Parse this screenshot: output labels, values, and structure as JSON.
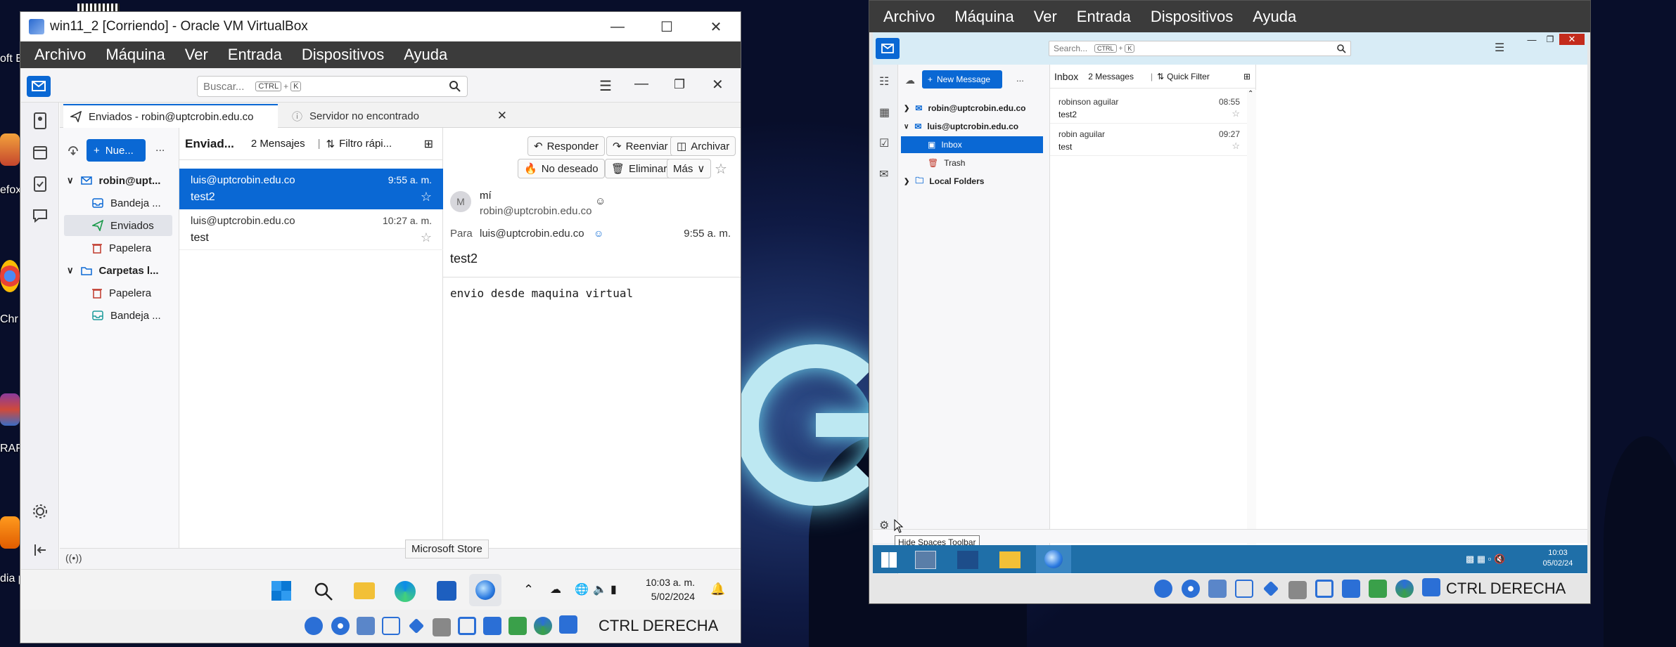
{
  "desktop": {
    "left_labels": [
      "oft E",
      "efox",
      "Chr",
      "RAF",
      "dia p"
    ],
    "tooltip_microsoft_store": "Microsoft Store"
  },
  "vbox_left": {
    "title": "win11_2 [Corriendo] - Oracle VM VirtualBox",
    "menu": [
      "Archivo",
      "Máquina",
      "Ver",
      "Entrada",
      "Dispositivos",
      "Ayuda"
    ],
    "host_key": "CTRL DERECHA",
    "thunderbird": {
      "search_placeholder": "Buscar...",
      "search_kbd1": "CTRL",
      "search_plus": "+",
      "search_kbd2": "K",
      "tab_active": "Enviados - robin@uptcrobin.edu.co",
      "tab_other": "Servidor no encontrado",
      "new_button": "Nue...",
      "more_dots": "...",
      "folders": {
        "account1": "robin@upt...",
        "inbox": "Bandeja ...",
        "sent": "Enviados",
        "trash": "Papelera",
        "local": "Carpetas l...",
        "local_trash": "Papelera",
        "local_inbox": "Bandeja ..."
      },
      "list_header": {
        "folder": "Enviad...",
        "count": "2 Mensajes",
        "filter": "Filtro rápi..."
      },
      "messages": [
        {
          "to": "luis@uptcrobin.edu.co",
          "time": "9:55 a. m.",
          "subject": "test2"
        },
        {
          "to": "luis@uptcrobin.edu.co",
          "time": "10:27 a. m.",
          "subject": "test"
        }
      ],
      "actions": {
        "reply": "Responder",
        "forward": "Reenviar",
        "archive": "Archivar",
        "junk": "No deseado",
        "delete": "Eliminar",
        "more": "Más"
      },
      "message": {
        "avatar": "M",
        "from_name": "mí",
        "from_email": "robin@uptcrobin.edu.co",
        "to_label": "Para",
        "to_email": "luis@uptcrobin.edu.co",
        "time": "9:55 a. m.",
        "subject": "test2",
        "body": "envio desde maquina virtual"
      }
    },
    "taskbar": {
      "time": "10:03 a. m.",
      "date": "5/02/2024"
    }
  },
  "vbox_right": {
    "menu": [
      "Archivo",
      "Máquina",
      "Ver",
      "Entrada",
      "Dispositivos",
      "Ayuda"
    ],
    "host_key": "CTRL DERECHA",
    "thunderbird": {
      "search_placeholder": "Search...",
      "search_kbd1": "CTRL",
      "search_plus": "+",
      "search_kbd2": "K",
      "new_message": "New Message",
      "more_dots": "...",
      "folders": {
        "account1": "robin@uptcrobin.edu.co",
        "account2": "luis@uptcrobin.edu.co",
        "inbox": "Inbox",
        "trash": "Trash",
        "local": "Local Folders"
      },
      "list_header": {
        "folder": "Inbox",
        "count": "2 Messages",
        "filter": "Quick Filter"
      },
      "messages": [
        {
          "from": "robinson aguilar",
          "time": "08:55",
          "subject": "test2"
        },
        {
          "from": "robin aguilar",
          "time": "09:27",
          "subject": "test"
        }
      ],
      "tooltip": "Hide Spaces Toolbar"
    },
    "taskbar": {
      "time": "10:03",
      "date": "05/02/24"
    }
  },
  "colors": {
    "accent": "#0a68d4",
    "virtualbox_menu": "#3b3b3b",
    "win10_taskbar": "#1f6fa8"
  }
}
